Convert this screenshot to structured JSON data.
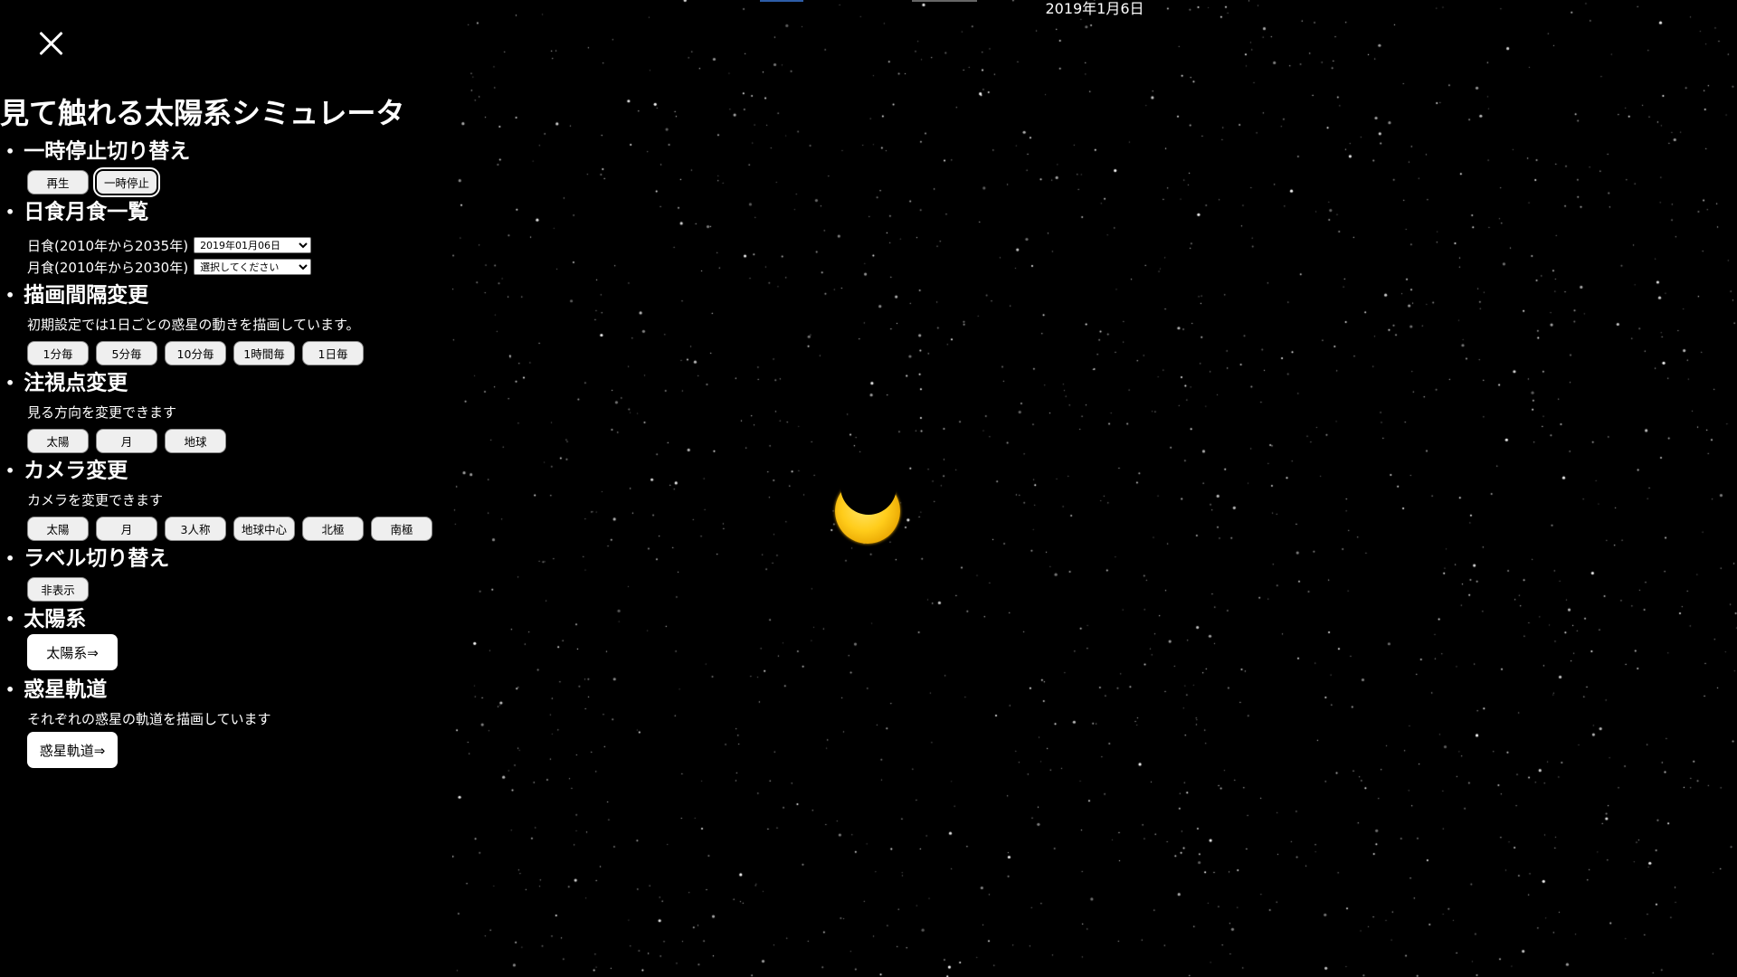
{
  "app": {
    "title": "見て触れる太陽系シミュレータ"
  },
  "icons": {
    "close": "close-icon"
  },
  "sections": {
    "pause": {
      "heading": "一時停止切り替え",
      "buttons": [
        "再生",
        "一時停止"
      ],
      "active": "一時停止"
    },
    "eclipse": {
      "heading": "日食月食一覧",
      "solar_label": "日食(2010年から2035年)",
      "solar_selected": "2019年01月06日",
      "lunar_label": "月食(2010年から2030年)",
      "lunar_selected": "選択してください"
    },
    "interval": {
      "heading": "描画間隔変更",
      "description": "初期設定では1日ごとの惑星の動きを描画しています。",
      "buttons": [
        "1分毎",
        "5分毎",
        "10分毎",
        "1時間毎",
        "1日毎"
      ]
    },
    "focus": {
      "heading": "注視点変更",
      "description": "見る方向を変更できます",
      "buttons": [
        "太陽",
        "月",
        "地球"
      ]
    },
    "camera": {
      "heading": "カメラ変更",
      "description": "カメラを変更できます",
      "buttons": [
        "太陽",
        "月",
        "3人称",
        "地球中心",
        "北極",
        "南極"
      ]
    },
    "label": {
      "heading": "ラベル切り替え",
      "button": "非表示"
    },
    "solar_system": {
      "heading": "太陽系",
      "button": "太陽系⇒"
    },
    "orbit": {
      "heading": "惑星軌道",
      "description": "それぞれの惑星の軌道を描画しています",
      "button": "惑星軌道⇒"
    }
  },
  "bullet": "•",
  "viewport": {
    "date": "2019年1月6日",
    "colors": {
      "background": "#000000",
      "sun": "#ffcc1a",
      "moon": "#000000"
    }
  }
}
